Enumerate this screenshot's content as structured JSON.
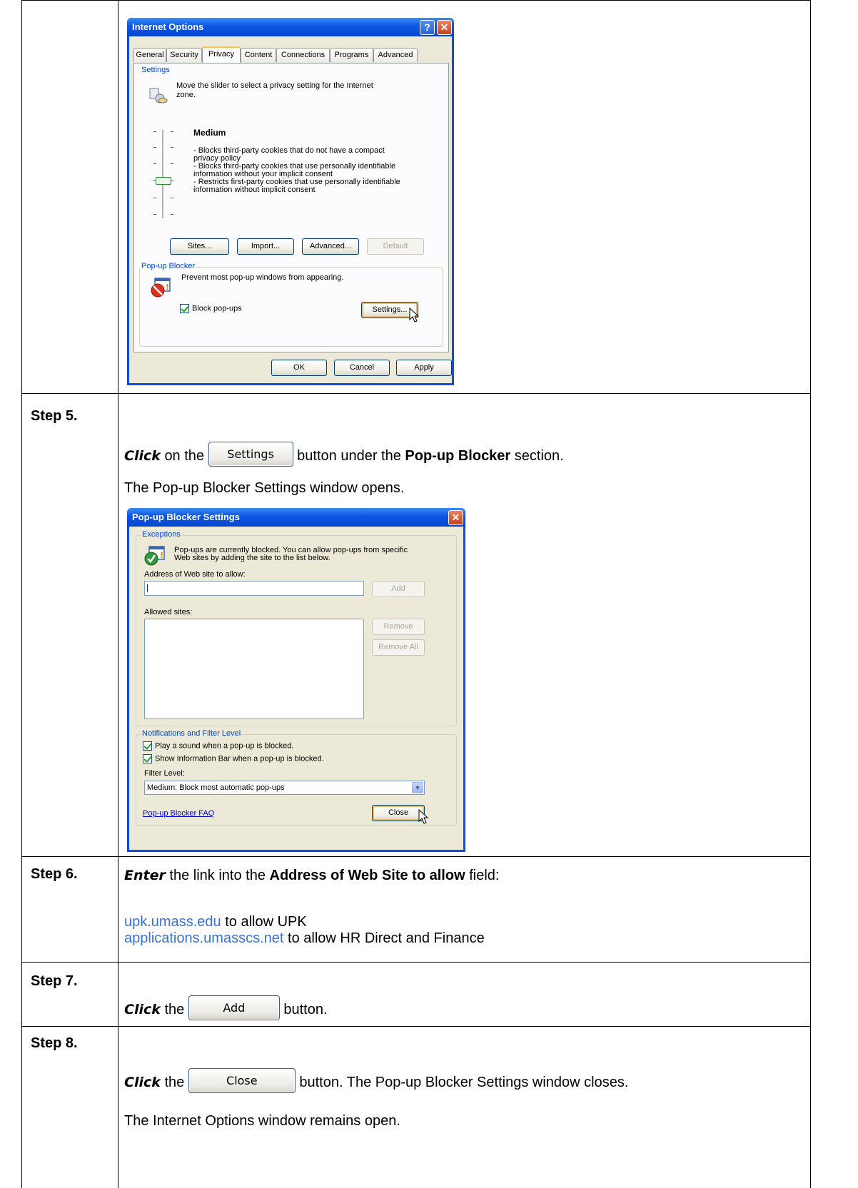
{
  "internet_options": {
    "title": "Internet Options",
    "tabs": [
      "General",
      "Security",
      "Privacy",
      "Content",
      "Connections",
      "Programs",
      "Advanced"
    ],
    "settings_group": "Settings",
    "settings_desc_1": "Move the slider to select a privacy setting for the Internet",
    "settings_desc_2": "zone.",
    "level_name": "Medium",
    "level_lines": [
      "- Blocks third-party cookies that do not have a compact",
      "privacy policy",
      "- Blocks third-party cookies that use personally identifiable",
      "information without your implicit consent",
      "- Restricts first-party cookies that use personally identifiable",
      "information without implicit consent"
    ],
    "btn_sites": "Sites...",
    "btn_import": "Import...",
    "btn_advanced": "Advanced...",
    "btn_default": "Default",
    "popup_group": "Pop-up Blocker",
    "popup_desc": "Prevent most pop-up windows from appearing.",
    "block_popups": "Block pop-ups",
    "btn_settings": "Settings...",
    "btn_ok": "OK",
    "btn_cancel": "Cancel",
    "btn_apply": "Apply"
  },
  "step5": {
    "label": "Step 5.",
    "click": "Click",
    "on_the": "on the",
    "settings_btn": "Settings",
    "after_btn": "button under the",
    "bold_section": "Pop-up Blocker",
    "section": "section.",
    "result": "The Pop-up Blocker Settings window opens."
  },
  "popup_settings": {
    "title": "Pop-up Blocker Settings",
    "exceptions_group": "Exceptions",
    "desc_1": "Pop-ups are currently blocked.  You can allow pop-ups from specific",
    "desc_2": "Web sites by adding the site to the list below.",
    "address_label": "Address of Web site to allow:",
    "address_value": "|",
    "btn_add": "Add",
    "allowed_label": "Allowed sites:",
    "btn_remove": "Remove",
    "btn_remove_all": "Remove All",
    "notif_group": "Notifications and Filter Level",
    "play_sound": "Play a sound when a pop-up is blocked.",
    "show_bar": "Show Information Bar when a pop-up is blocked.",
    "filter_label": "Filter Level:",
    "filter_value": "Medium: Block most automatic pop-ups",
    "faq_link": "Pop-up Blocker FAQ",
    "btn_close": "Close"
  },
  "step6": {
    "label": "Step 6.",
    "enter": "Enter",
    "text_1": "the link into the",
    "bold_field": "Address of Web Site to allow",
    "text_2": "field:",
    "link_1": "upk.umass.edu",
    "link_1_text": "to  allow UPK",
    "link_2": "applications.umasscs.net",
    "link_2_text": "to allow HR Direct and Finance"
  },
  "step7": {
    "label": "Step 7.",
    "click": "Click",
    "the": "the",
    "btn": "Add",
    "after": "button."
  },
  "step8": {
    "label": "Step 8.",
    "click": "Click",
    "the": "the",
    "btn": "Close",
    "after": "button.  The Pop-up Blocker Settings window closes.",
    "result": "The Internet Options window remains open."
  }
}
